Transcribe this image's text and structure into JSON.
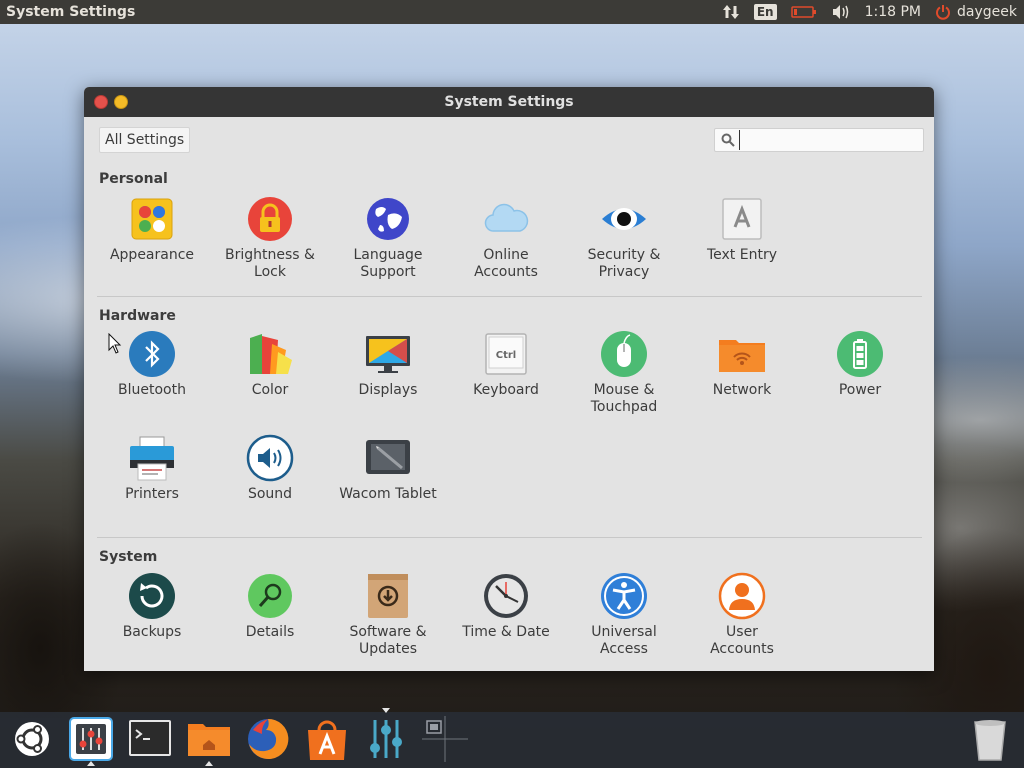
{
  "top_panel": {
    "app_title": "System Settings",
    "keyboard_layout": "En",
    "time": "1:18 PM",
    "username": "daygeek"
  },
  "window": {
    "title": "System Settings",
    "all_settings_label": "All Settings",
    "search": {
      "value": "",
      "placeholder": ""
    }
  },
  "sections": {
    "personal": {
      "title": "Personal",
      "items": [
        {
          "label_1": "Appearance",
          "label_2": "",
          "icon": "appearance-icon"
        },
        {
          "label_1": "Brightness &",
          "label_2": "Lock",
          "icon": "brightness-lock-icon"
        },
        {
          "label_1": "Language",
          "label_2": "Support",
          "icon": "language-globe-icon"
        },
        {
          "label_1": "Online",
          "label_2": "Accounts",
          "icon": "online-accounts-cloud-icon"
        },
        {
          "label_1": "Security &",
          "label_2": "Privacy",
          "icon": "security-eye-icon"
        },
        {
          "label_1": "Text Entry",
          "label_2": "",
          "icon": "text-entry-icon"
        }
      ]
    },
    "hardware": {
      "title": "Hardware",
      "items": [
        {
          "label_1": "Bluetooth",
          "label_2": "",
          "icon": "bluetooth-icon"
        },
        {
          "label_1": "Color",
          "label_2": "",
          "icon": "color-icon"
        },
        {
          "label_1": "Displays",
          "label_2": "",
          "icon": "displays-icon"
        },
        {
          "label_1": "Keyboard",
          "label_2": "",
          "icon": "keyboard-icon",
          "key_text": "Ctrl"
        },
        {
          "label_1": "Mouse &",
          "label_2": "Touchpad",
          "icon": "mouse-icon"
        },
        {
          "label_1": "Network",
          "label_2": "",
          "icon": "network-icon"
        },
        {
          "label_1": "Power",
          "label_2": "",
          "icon": "power-battery-icon"
        },
        {
          "label_1": "Printers",
          "label_2": "",
          "icon": "printer-icon"
        },
        {
          "label_1": "Sound",
          "label_2": "",
          "icon": "sound-icon"
        },
        {
          "label_1": "Wacom Tablet",
          "label_2": "",
          "icon": "wacom-tablet-icon"
        }
      ]
    },
    "system": {
      "title": "System",
      "items": [
        {
          "label_1": "Backups",
          "label_2": "",
          "icon": "backups-icon"
        },
        {
          "label_1": "Details",
          "label_2": "",
          "icon": "details-icon"
        },
        {
          "label_1": "Software &",
          "label_2": "Updates",
          "icon": "software-updates-icon"
        },
        {
          "label_1": "Time & Date",
          "label_2": "",
          "icon": "time-date-clock-icon"
        },
        {
          "label_1": "Universal",
          "label_2": "Access",
          "icon": "universal-access-icon"
        },
        {
          "label_1": "User",
          "label_2": "Accounts",
          "icon": "user-accounts-icon"
        }
      ]
    }
  },
  "launcher": {
    "items": [
      {
        "name": "ubuntu-dash-icon",
        "active": false
      },
      {
        "name": "system-settings-launcher-icon",
        "active": true
      },
      {
        "name": "terminal-icon",
        "active": false
      },
      {
        "name": "files-folder-icon",
        "active": true
      },
      {
        "name": "firefox-icon",
        "active": false
      },
      {
        "name": "software-center-icon",
        "active": false
      },
      {
        "name": "mixer-settings-icon",
        "active": true
      },
      {
        "name": "workspace-switcher-icon",
        "active": false
      },
      {
        "name": "trash-icon",
        "active": false
      }
    ]
  },
  "colors": {
    "panel": "#3c3b37",
    "window_bg": "#e3e3e3",
    "titlebar": "#353535",
    "close": "#e5514b",
    "minimize": "#f4bb27",
    "power_red": "#e04b2b"
  }
}
